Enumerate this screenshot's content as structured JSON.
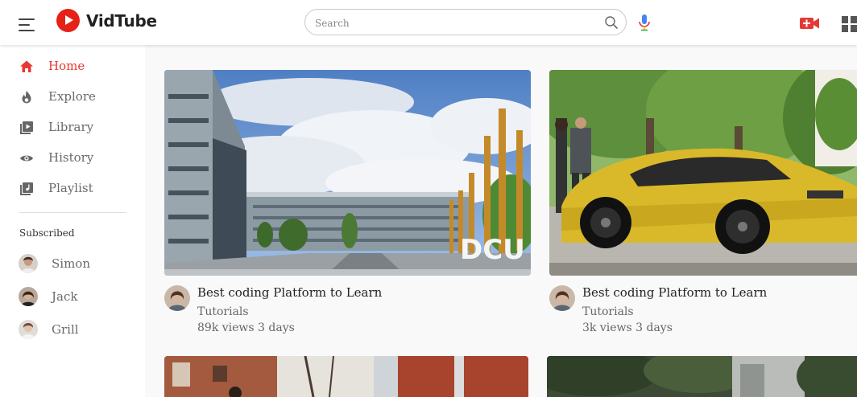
{
  "brand": {
    "name": "VidTube",
    "color": "#e62117"
  },
  "search": {
    "placeholder": "Search"
  },
  "header_icons": [
    "menu-icon",
    "search-icon",
    "microphone-icon",
    "video-camera-add-icon",
    "apps-grid-icon"
  ],
  "sidebar": {
    "items": [
      {
        "label": "Home",
        "icon": "home-icon",
        "active": true
      },
      {
        "label": "Explore",
        "icon": "explore-icon",
        "active": false
      },
      {
        "label": "Library",
        "icon": "library-icon",
        "active": false
      },
      {
        "label": "History",
        "icon": "history-icon",
        "active": false
      },
      {
        "label": "Playlist",
        "icon": "playlist-icon",
        "active": false
      }
    ],
    "subscribed_heading": "Subscribed",
    "subscribed": [
      {
        "name": "Simon"
      },
      {
        "name": "Jack"
      },
      {
        "name": "Grill"
      }
    ]
  },
  "videos": [
    {
      "title": "Best coding Platform to Learn",
      "channel": "Tutorials",
      "views": "89k views",
      "age": "3 days",
      "thumbnail_text": "DCU"
    },
    {
      "title": "Best coding Platform to Learn",
      "channel": "Tutorials",
      "views": "3k views",
      "age": "3 days"
    },
    {},
    {}
  ],
  "colors": {
    "accent": "#e53935",
    "inactive_text": "#6a6a6a",
    "background": "#f9f9f9"
  }
}
